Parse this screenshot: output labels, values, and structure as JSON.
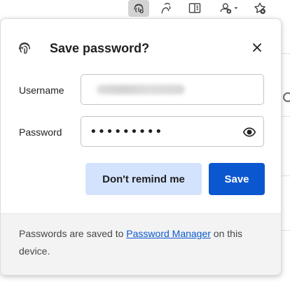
{
  "toolbar": {
    "icons": [
      "fingerprint-key-icon",
      "read-aloud-icon",
      "reading-view-icon",
      "extensions-icon",
      "favorites-add-icon"
    ]
  },
  "dialog": {
    "title": "Save password?",
    "icon": "fingerprint-icon",
    "close_icon": "close-icon",
    "username_label": "Username",
    "password_label": "Password",
    "password_masked": "•••••••••",
    "show_password_icon": "eye-icon",
    "dont_remind_label": "Don't remind me",
    "save_label": "Save",
    "footer_prefix": "Passwords are saved to ",
    "footer_link": "Password Manager",
    "footer_suffix": " on this device."
  },
  "colors": {
    "primary_button": "#0b57d0",
    "secondary_button": "#d3e3fd",
    "link": "#0b57d0",
    "footer_bg": "#f3f3f3"
  }
}
